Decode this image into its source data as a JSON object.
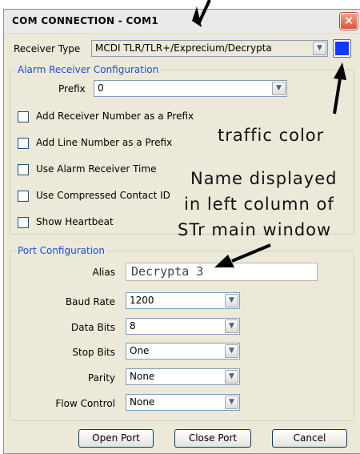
{
  "window": {
    "title": "COM CONNECTION - COM1"
  },
  "receiver": {
    "label": "Receiver Type",
    "value": "MCDI TLR/TLR+/Exprecium/Decrypta"
  },
  "alarm_group": {
    "label": "Alarm Receiver Configuration",
    "prefix_label": "Prefix",
    "prefix_value": "0",
    "checkboxes": [
      {
        "label": "Add Receiver Number as a Prefix",
        "checked": false
      },
      {
        "label": "Add Line Number as a Prefix",
        "checked": false
      },
      {
        "label": "Use Alarm Receiver Time",
        "checked": false
      },
      {
        "label": "Use Compressed Contact ID",
        "checked": false
      },
      {
        "label": "Show Heartbeat",
        "checked": false
      }
    ]
  },
  "port_group": {
    "label": "Port Configuration",
    "alias": {
      "label": "Alias",
      "value": "Decrypta 3"
    },
    "fields": [
      {
        "label": "Baud Rate",
        "value": "1200"
      },
      {
        "label": "Data Bits",
        "value": "8"
      },
      {
        "label": "Stop Bits",
        "value": "One"
      },
      {
        "label": "Parity",
        "value": "None"
      },
      {
        "label": "Flow Control",
        "value": "None"
      }
    ]
  },
  "buttons": {
    "open": "Open Port",
    "close": "Close Port",
    "cancel": "Cancel"
  },
  "annotations": {
    "traffic": "traffic color",
    "name_line1": "Name displayed",
    "name_line2": "in left column of",
    "name_line3": "STr main window"
  },
  "colors": {
    "traffic_color": "#0a3bff",
    "group_label": "#1b4fd6"
  }
}
